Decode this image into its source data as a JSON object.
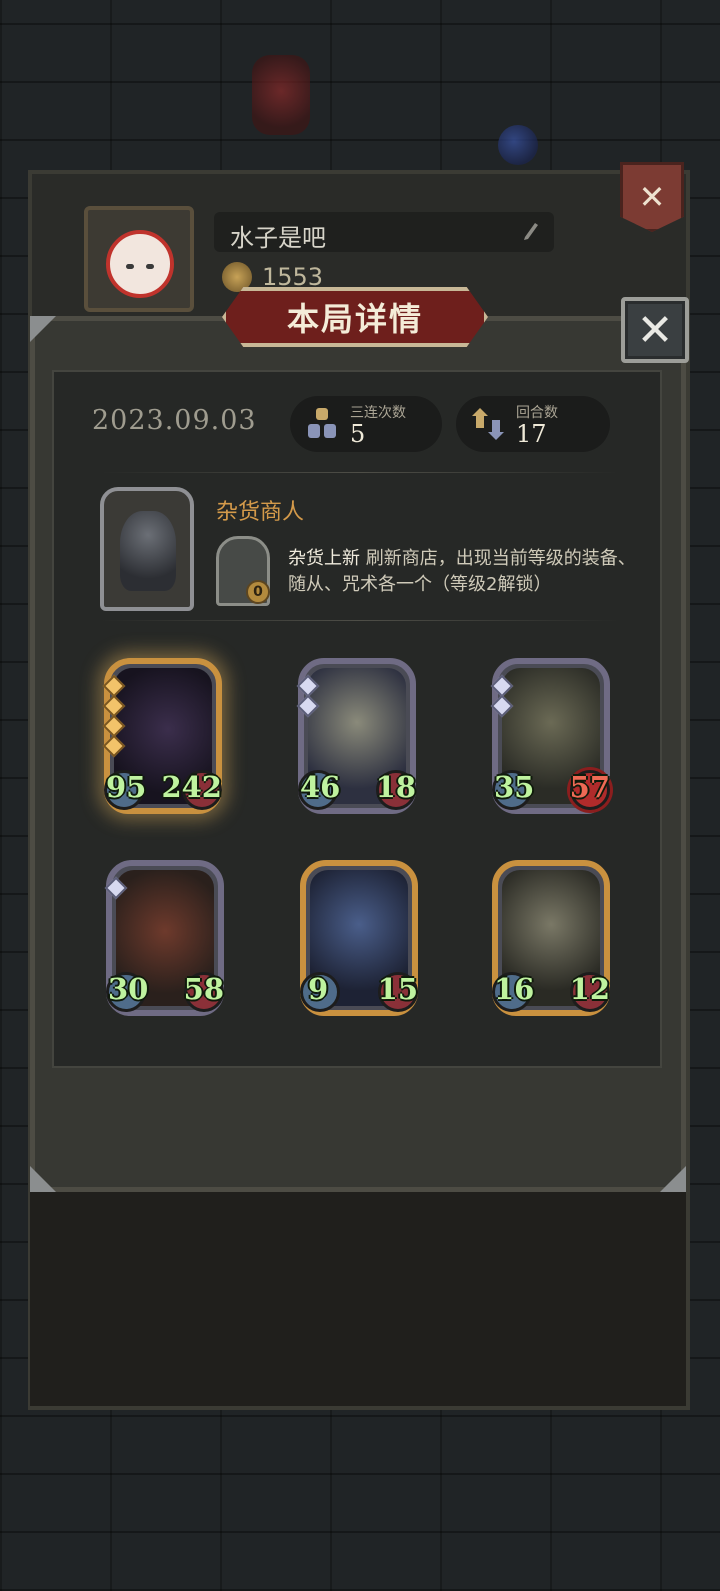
{
  "profile": {
    "name": "水子是吧",
    "coins": "1553"
  },
  "dialog": {
    "title": "本局详情",
    "date": "2023.09.03",
    "stats": [
      {
        "label": "三连次数",
        "value": "5",
        "icon": "triple-icon"
      },
      {
        "label": "回合数",
        "value": "17",
        "icon": "rounds-icon"
      }
    ],
    "merchant": {
      "name": "杂货商人",
      "skill_name": "杂货上新",
      "skill_desc": " 刷新商店，出现当前等级的装备、随从、咒术各一个（等级2解锁）",
      "skill_cost": "0"
    },
    "cards": [
      {
        "attack": "95",
        "health": "242",
        "frame": "gold",
        "gems": 4
      },
      {
        "attack": "46",
        "health": "18",
        "frame": "silver",
        "gems": 2
      },
      {
        "attack": "35",
        "health": "57",
        "frame": "silver",
        "gems": 2,
        "health_buffed": true
      },
      {
        "attack": "30",
        "health": "58",
        "frame": "silver",
        "gems": 1
      },
      {
        "attack": "9",
        "health": "15",
        "frame": "gold",
        "gems": 0
      },
      {
        "attack": "16",
        "health": "12",
        "frame": "gold",
        "gems": 0
      }
    ]
  },
  "colors": {
    "accent_gold": "#d49a4a",
    "stat_green": "#bff39f",
    "banner_red": "#6e1f1c"
  }
}
